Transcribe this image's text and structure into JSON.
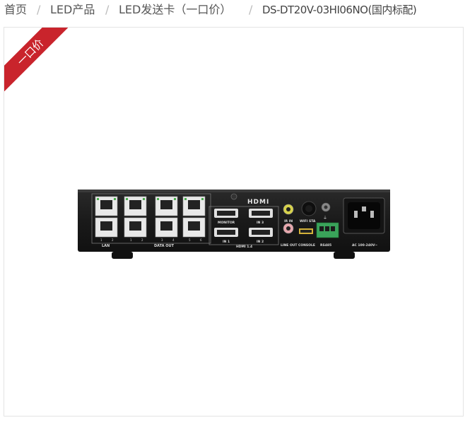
{
  "breadcrumb": {
    "items": [
      "首页",
      "LED产品",
      "LED发送卡（一口价）",
      "DS-DT20V-03HI06NO(国内标配)"
    ],
    "separator": "/"
  },
  "badge": {
    "text": "一口价",
    "color": "#c9242c"
  },
  "device": {
    "hdmi_logo": "HDMI",
    "labels": {
      "lan": "LAN",
      "data_out": "DATA OUT",
      "monitor": "MONITOR",
      "in3": "IN 3",
      "in1": "IN 1",
      "in2": "IN 2",
      "hdmi14": "HDMI 1.4",
      "ir_in": "IR IN",
      "wifi_sta": "WIFI STA",
      "line_out": "LINE OUT",
      "console": "CONSOLE",
      "rs485": "RS485",
      "ac": "AC 100-240V~"
    },
    "port_numbers": [
      "1",
      "2",
      "1",
      "2",
      "3",
      "4",
      "5",
      "6"
    ]
  }
}
